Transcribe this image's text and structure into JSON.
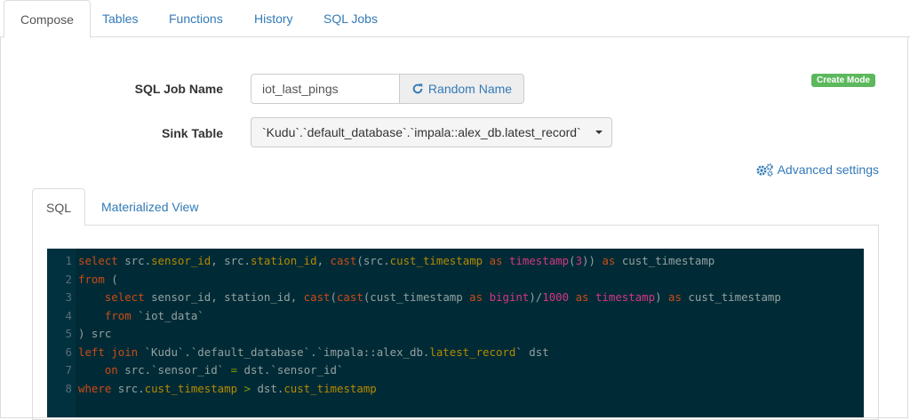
{
  "top_tabs": [
    {
      "label": "Compose",
      "active": true
    },
    {
      "label": "Tables"
    },
    {
      "label": "Functions"
    },
    {
      "label": "History"
    },
    {
      "label": "SQL Jobs"
    }
  ],
  "form": {
    "job_name_label": "SQL Job Name",
    "job_name_value": "iot_last_pings",
    "random_button_label": "Random Name",
    "sink_table_label": "Sink Table",
    "sink_table_value": "`Kudu`.`default_database`.`impala::alex_db.latest_record`",
    "mode_badge": "Create Mode",
    "advanced_link": "Advanced settings"
  },
  "sub_tabs": [
    {
      "label": "SQL",
      "active": true
    },
    {
      "label": "Materialized View"
    }
  ],
  "editor": {
    "line_numbers": [
      "1",
      "2",
      "3",
      "4",
      "5",
      "6",
      "7",
      "8"
    ]
  },
  "colors": {
    "link": "#337ab7",
    "badge": "#5cb85c",
    "editor_bg": "#002b36"
  }
}
